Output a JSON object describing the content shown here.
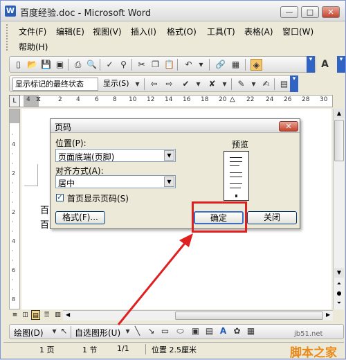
{
  "window": {
    "title": "百度经验.doc - Microsoft Word",
    "minimize": "—",
    "maximize": "□",
    "close": "✕"
  },
  "menu": {
    "items": [
      "文件(F)",
      "编辑(E)",
      "视图(V)",
      "插入(I)",
      "格式(O)",
      "工具(T)",
      "表格(A)",
      "窗口(W)"
    ],
    "help": "帮助(H)"
  },
  "toolbar_review": {
    "markup_select": "显示标记的最终状态",
    "show_menu": "显示(S)"
  },
  "ruler": {
    "marks": [
      "4",
      "2",
      "2",
      "4",
      "6",
      "8",
      "10",
      "12",
      "14",
      "16",
      "18",
      "20",
      "22",
      "24",
      "26",
      "28",
      "30"
    ]
  },
  "document": {
    "line1": "百",
    "line2": "百"
  },
  "dialog": {
    "title": "页码",
    "position_label": "位置(P):",
    "position_value": "页面底端(页脚)",
    "align_label": "对齐方式(A):",
    "align_value": "居中",
    "first_page_label": "首页显示页码(S)",
    "first_page_checked": true,
    "preview_label": "预览",
    "format_button": "格式(F)...",
    "ok_button": "确定",
    "close_button": "关闭"
  },
  "drawbar": {
    "draw_label": "绘图(D)",
    "autoshapes_label": "自选图形(U)"
  },
  "status": {
    "page": "1 页",
    "section": "1 节",
    "pages": "1/1",
    "position": "位置 2.5厘米"
  },
  "watermark": {
    "site": "jb51.net",
    "name": "脚本之家"
  },
  "colors": {
    "highlight": "#e02020",
    "arrow": "#e02020"
  }
}
